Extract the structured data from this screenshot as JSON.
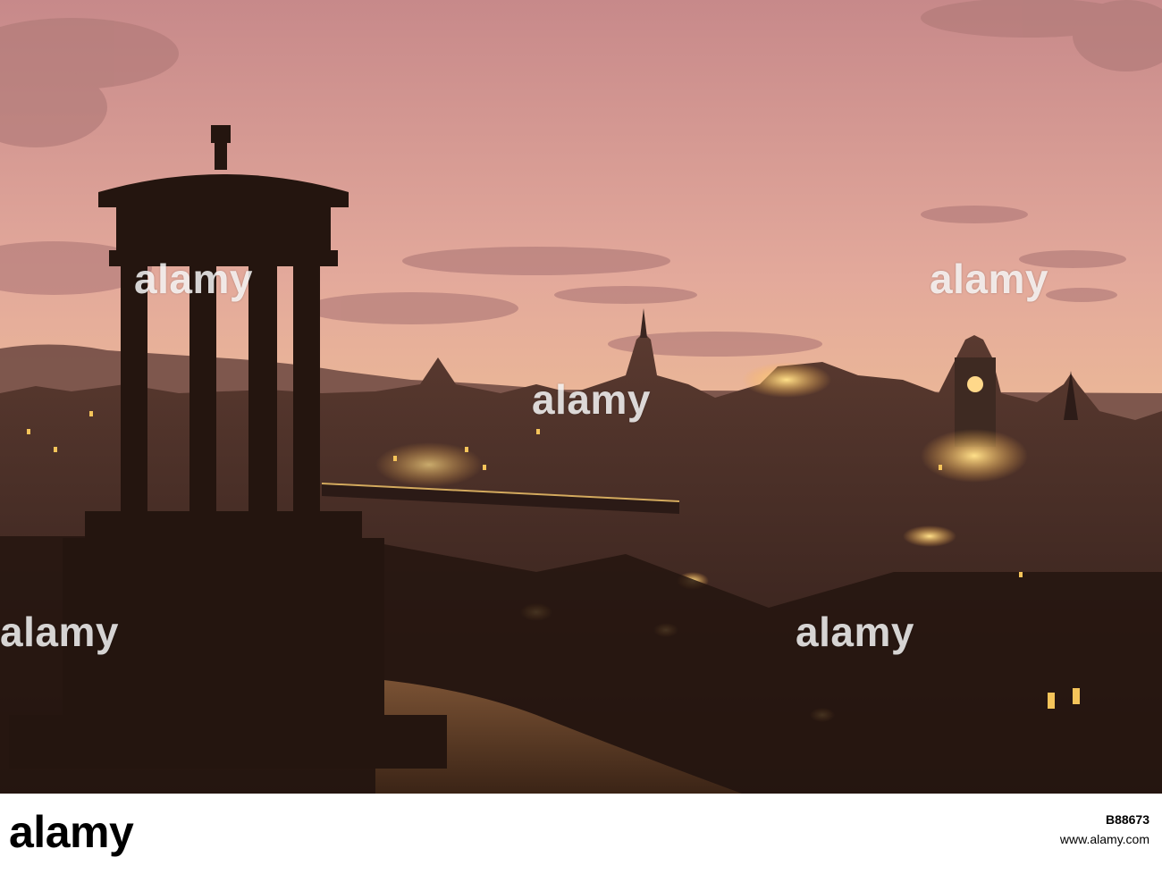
{
  "image": {
    "subject": "Edinburgh skyline at sunset from Calton Hill with Dugald Stewart Monument",
    "palette": {
      "sky_top": "#c98e88",
      "sky_mid": "#e7ae97",
      "sky_horizon": "#f2c793",
      "silhouette": "#2a1a1a",
      "city_dark": "#3a2520",
      "light_glow": "#ffd36b"
    }
  },
  "watermark": {
    "text": "alamy",
    "color": "#ffffff"
  },
  "footer": {
    "logo": "alamy",
    "domain": "www.alamy.com",
    "image_id": "B88673"
  }
}
